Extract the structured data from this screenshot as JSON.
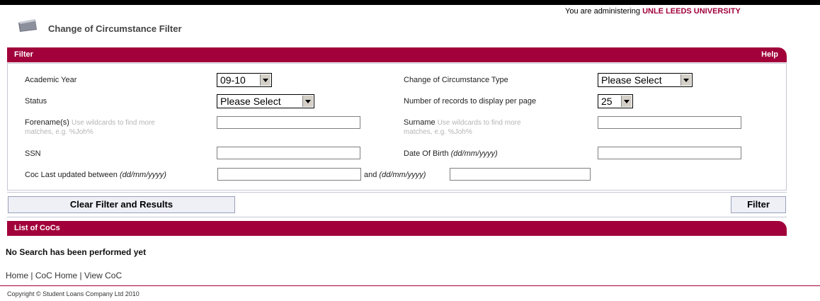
{
  "header": {
    "admin_prefix": "You are administering",
    "admin_org": "UNLE LEEDS UNIVERSITY",
    "title": "Change of Circumstance Filter",
    "icon": "folder-icon"
  },
  "filter_bar": {
    "label": "Filter",
    "help": "Help"
  },
  "filter": {
    "academic_year_label": "Academic Year",
    "academic_year_value": "09-10",
    "coc_type_label": "Change of Circumstance Type",
    "coc_type_value": "Please Select",
    "status_label": "Status",
    "status_value": "Please Select",
    "records_label": "Number of records to display per page",
    "records_value": "25",
    "forename_label": "Forename(s)",
    "forename_hint_1": "Use wildcards to find more",
    "forename_hint_2": "matches, e.g. %Joh%",
    "surname_label": "Surname",
    "surname_hint_1": "Use wildcards to find more",
    "surname_hint_2": "matches, e.g. %Joh%",
    "ssn_label": "SSN",
    "dob_label": "Date Of Birth",
    "dob_format": "(dd/mm/yyyy)",
    "coc_updated_label": "Coc Last updated between",
    "coc_updated_format": "(dd/mm/yyyy)",
    "and_label": "and",
    "and_format": "(dd/mm/yyyy)"
  },
  "buttons": {
    "clear": "Clear Filter and Results",
    "filter": "Filter"
  },
  "list_bar": {
    "label": "List of CoCs"
  },
  "results": {
    "empty_message": "No Search has been performed yet"
  },
  "footer": {
    "links": [
      "Home",
      "CoC Home",
      "View CoC"
    ],
    "separator": "|",
    "copyright": "Copyright © Student Loans Company Ltd 2010"
  },
  "colors": {
    "accent": "#a1003a",
    "panel_border": "#c6c9d6",
    "button_bg": "#eef0f6"
  }
}
